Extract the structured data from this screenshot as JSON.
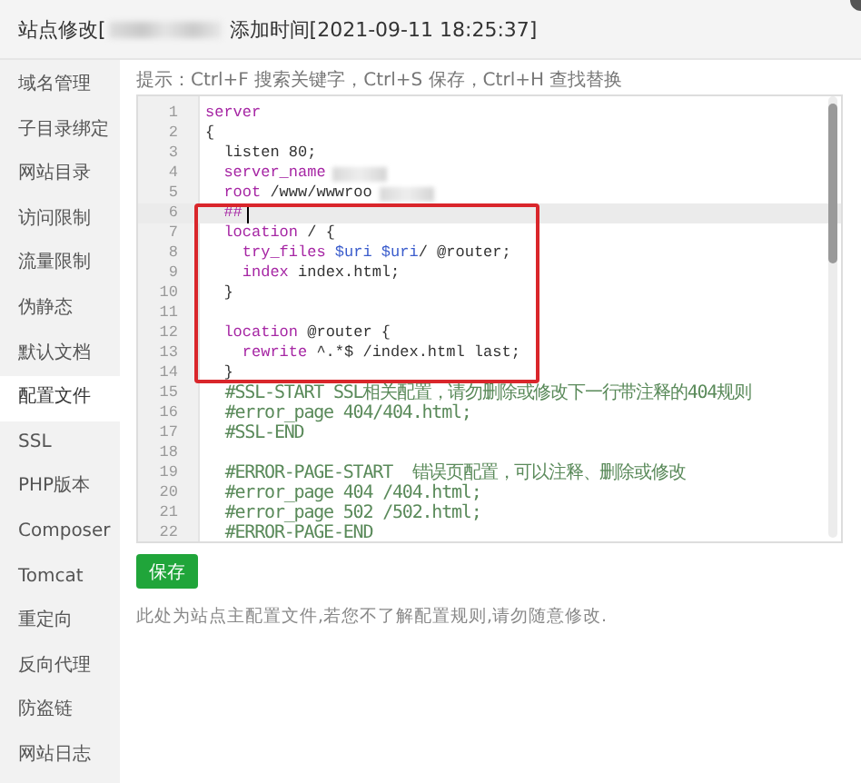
{
  "window": {
    "title_prefix": "站点修改[",
    "title_suffix": "添加时间[2021-09-11 18:25:37]"
  },
  "sidebar": {
    "items": [
      {
        "label": "域名管理",
        "selected": false
      },
      {
        "label": "子目录绑定",
        "selected": false
      },
      {
        "label": "网站目录",
        "selected": false
      },
      {
        "label": "访问限制",
        "selected": false
      },
      {
        "label": "流量限制",
        "selected": false
      },
      {
        "label": "伪静态",
        "selected": false
      },
      {
        "label": "默认文档",
        "selected": false
      },
      {
        "label": "配置文件",
        "selected": true
      },
      {
        "label": "SSL",
        "selected": false
      },
      {
        "label": "PHP版本",
        "selected": false
      },
      {
        "label": "Composer",
        "selected": false
      },
      {
        "label": "Tomcat",
        "selected": false
      },
      {
        "label": "重定向",
        "selected": false
      },
      {
        "label": "反向代理",
        "selected": false
      },
      {
        "label": "防盗链",
        "selected": false
      },
      {
        "label": "网站日志",
        "selected": false
      }
    ]
  },
  "hint": "提示：Ctrl+F 搜索关键字，Ctrl+S 保存，Ctrl+H 查找替换",
  "editor": {
    "blocks": [
      {
        "boxed": false,
        "lines": [
          {
            "number": "1",
            "active": false,
            "tokens": [
              {
                "kind": "keyword",
                "text": "server"
              }
            ]
          },
          {
            "number": "2",
            "active": false,
            "tokens": [
              {
                "kind": "plain",
                "text": "{"
              }
            ]
          },
          {
            "number": "3",
            "active": false,
            "tokens": [
              {
                "kind": "plain",
                "text": "  listen 80;"
              }
            ]
          },
          {
            "number": "4",
            "active": false,
            "tokens": [
              {
                "kind": "keyword",
                "text": "  server_name"
              },
              {
                "kind": "blur"
              }
            ]
          },
          {
            "number": "5",
            "active": false,
            "tokens": [
              {
                "kind": "keyword",
                "text": "  root"
              },
              {
                "kind": "plain",
                "text": " /www/wwwroo"
              },
              {
                "kind": "blur"
              }
            ]
          }
        ]
      },
      {
        "boxed": true,
        "lines": [
          {
            "number": "6",
            "active": true,
            "tokens": [
              {
                "kind": "keyword",
                "text": "  ##"
              }
            ]
          },
          {
            "number": "7",
            "active": false,
            "tokens": [
              {
                "kind": "keyword",
                "text": "  location"
              },
              {
                "kind": "plain",
                "text": " / {"
              }
            ]
          },
          {
            "number": "8",
            "active": false,
            "tokens": [
              {
                "kind": "keyword",
                "text": "    try_files"
              },
              {
                "kind": "variable",
                "text": " $uri"
              },
              {
                "kind": "variable",
                "text": " $uri"
              },
              {
                "kind": "plain",
                "text": "/ @router;"
              }
            ]
          },
          {
            "number": "9",
            "active": false,
            "tokens": [
              {
                "kind": "keyword",
                "text": "    index"
              },
              {
                "kind": "plain",
                "text": " index.html;"
              }
            ]
          },
          {
            "number": "10",
            "active": false,
            "tokens": [
              {
                "kind": "plain",
                "text": "  }"
              }
            ]
          },
          {
            "number": "11",
            "active": false
          },
          {
            "number": "12",
            "active": false,
            "tokens": [
              {
                "kind": "keyword",
                "text": "  location"
              },
              {
                "kind": "plain",
                "text": " @router {"
              }
            ]
          },
          {
            "number": "13",
            "active": false,
            "tokens": [
              {
                "kind": "keyword",
                "text": "    rewrite"
              },
              {
                "kind": "plain",
                "text": " ^.*$ /index.html last;"
              }
            ]
          },
          {
            "number": "14",
            "active": false,
            "tokens": [
              {
                "kind": "plain",
                "text": "  }"
              }
            ]
          }
        ]
      },
      {
        "boxed": false,
        "lines": [
          {
            "number": "15",
            "active": false,
            "tokens": [
              {
                "kind": "comment",
                "text": "  #SSL-START SSL相关配置，请勿删除或修改下一行带注释的404规则"
              }
            ]
          },
          {
            "number": "16",
            "active": false,
            "tokens": [
              {
                "kind": "comment",
                "text": "  #error_page 404/404.html;"
              }
            ]
          },
          {
            "number": "17",
            "active": false,
            "tokens": [
              {
                "kind": "comment",
                "text": "  #SSL-END"
              }
            ]
          },
          {
            "number": "18",
            "active": false
          },
          {
            "number": "19",
            "active": false,
            "tokens": [
              {
                "kind": "comment",
                "text": "  #ERROR-PAGE-START  错误页配置，可以注释、删除或修改"
              }
            ]
          },
          {
            "number": "20",
            "active": false,
            "tokens": [
              {
                "kind": "comment",
                "text": "  #error_page 404 /404.html;"
              }
            ]
          },
          {
            "number": "21",
            "active": false,
            "tokens": [
              {
                "kind": "comment",
                "text": "  #error_page 502 /502.html;"
              }
            ]
          },
          {
            "number": "22",
            "active": false,
            "tokens": [
              {
                "kind": "comment",
                "text": "  #ERROR-PAGE-END"
              }
            ]
          }
        ]
      }
    ]
  },
  "save_button": "保存",
  "note": "此处为站点主配置文件,若您不了解配置规则,请勿随意修改."
}
